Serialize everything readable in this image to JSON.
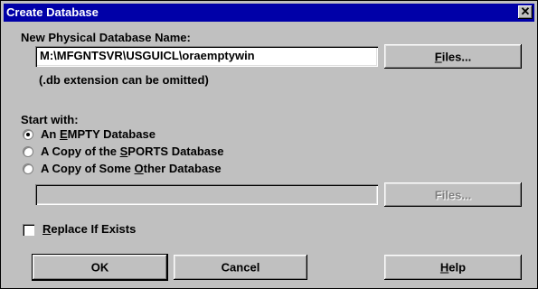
{
  "window": {
    "title": "Create Database",
    "close_glyph": "✕"
  },
  "db_name": {
    "label": "New Physical Database Name:",
    "value": "M:\\MFGNTSVR\\USGUICL\\oraemptywin",
    "files_button": "Files...",
    "hint": "(.db extension can be omitted)"
  },
  "start_with": {
    "label": "Start with:",
    "options": [
      {
        "pre": "An ",
        "accel": "E",
        "post": "MPTY Database",
        "selected": true
      },
      {
        "pre": "A Copy of the ",
        "accel": "S",
        "post": "PORTS Database",
        "selected": false
      },
      {
        "pre": "A Copy of Some ",
        "accel": "O",
        "post": "ther Database",
        "selected": false
      }
    ],
    "other_path_value": "",
    "files_button": "Files..."
  },
  "replace": {
    "accel": "R",
    "post": "eplace If Exists",
    "checked": false
  },
  "buttons": {
    "ok": "OK",
    "cancel": "Cancel",
    "help_accel": "H",
    "help_post": "elp"
  }
}
